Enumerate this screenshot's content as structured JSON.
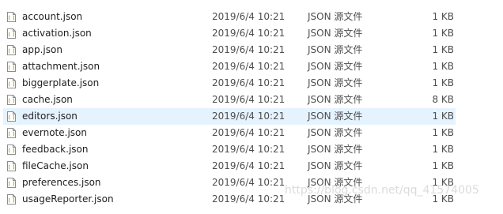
{
  "files": [
    {
      "name": "account.json",
      "modified": "2019/6/4 10:21",
      "type": "JSON 源文件",
      "size": "1 KB",
      "icon": "json-file-icon",
      "selected": false
    },
    {
      "name": "activation.json",
      "modified": "2019/6/4 10:21",
      "type": "JSON 源文件",
      "size": "1 KB",
      "icon": "json-file-icon",
      "selected": false
    },
    {
      "name": "app.json",
      "modified": "2019/6/4 10:21",
      "type": "JSON 源文件",
      "size": "1 KB",
      "icon": "json-file-icon",
      "selected": false
    },
    {
      "name": "attachment.json",
      "modified": "2019/6/4 10:21",
      "type": "JSON 源文件",
      "size": "1 KB",
      "icon": "json-file-icon",
      "selected": false
    },
    {
      "name": "biggerplate.json",
      "modified": "2019/6/4 10:21",
      "type": "JSON 源文件",
      "size": "1 KB",
      "icon": "json-file-icon",
      "selected": false
    },
    {
      "name": "cache.json",
      "modified": "2019/6/4 10:21",
      "type": "JSON 源文件",
      "size": "8 KB",
      "icon": "json-file-icon",
      "selected": false
    },
    {
      "name": "editors.json",
      "modified": "2019/6/4 10:21",
      "type": "JSON 源文件",
      "size": "1 KB",
      "icon": "json-file-icon",
      "selected": true
    },
    {
      "name": "evernote.json",
      "modified": "2019/6/4 10:21",
      "type": "JSON 源文件",
      "size": "1 KB",
      "icon": "json-file-icon",
      "selected": false
    },
    {
      "name": "feedback.json",
      "modified": "2019/6/4 10:21",
      "type": "JSON 源文件",
      "size": "1 KB",
      "icon": "json-file-icon",
      "selected": false
    },
    {
      "name": "fileCache.json",
      "modified": "2019/6/4 10:21",
      "type": "JSON 源文件",
      "size": "1 KB",
      "icon": "json-file-icon",
      "selected": false
    },
    {
      "name": "preferences.json",
      "modified": "2019/6/4 10:21",
      "type": "JSON 源文件",
      "size": "1 KB",
      "icon": "json-file-icon",
      "selected": false
    },
    {
      "name": "usageReporter.json",
      "modified": "2019/6/4 10:21",
      "type": "JSON 源文件",
      "size": "1 KB",
      "icon": "json-file-icon",
      "selected": false
    }
  ],
  "watermark": "https://blog.csdn.net/qq_41574005",
  "colors": {
    "selection": "#e5f3ff",
    "text": "#1e1e1e",
    "secondary_text": "#4e4e4e"
  }
}
